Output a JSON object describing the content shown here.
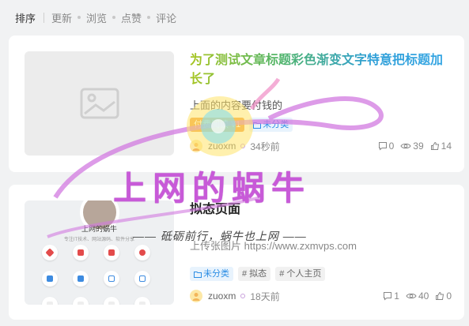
{
  "sortbar": {
    "title": "排序",
    "options": [
      "更新",
      "浏览",
      "点赞",
      "评论"
    ]
  },
  "posts": [
    {
      "title": "为了测试文章标题彩色渐变文字特意把标题加长了",
      "excerpt": "上面的内容要付钱的",
      "tags": {
        "paid": "付费阅读 ¥1",
        "category": "未分类"
      },
      "author": "zuoxm",
      "time": "34秒前",
      "comments": "0",
      "views": "39",
      "likes": "14",
      "thumbnail": "image-placeholder-icon"
    },
    {
      "title": "拟态页面",
      "excerpt": "上传张图片 https://www.zxmvps.com",
      "tags": {
        "category": "未分类",
        "tag1": "# 拟态",
        "tag2": "# 个人主页"
      },
      "author": "zuoxm",
      "time": "18天前",
      "comments": "1",
      "views": "40",
      "likes": "0",
      "thumbnail_app": {
        "name": "上网的蜗牛",
        "desc": "专注IT技术、网站源码、软件分享"
      }
    }
  ],
  "watermark": {
    "main": "上网的蜗牛",
    "sub": "—— 砥砺前行，蜗牛也上网 ——",
    "url": "https://www.zxmvps.com"
  },
  "colors": {
    "accent": "#2b8de4",
    "paid": "#f1a142",
    "watermark": "#c85ad8"
  }
}
